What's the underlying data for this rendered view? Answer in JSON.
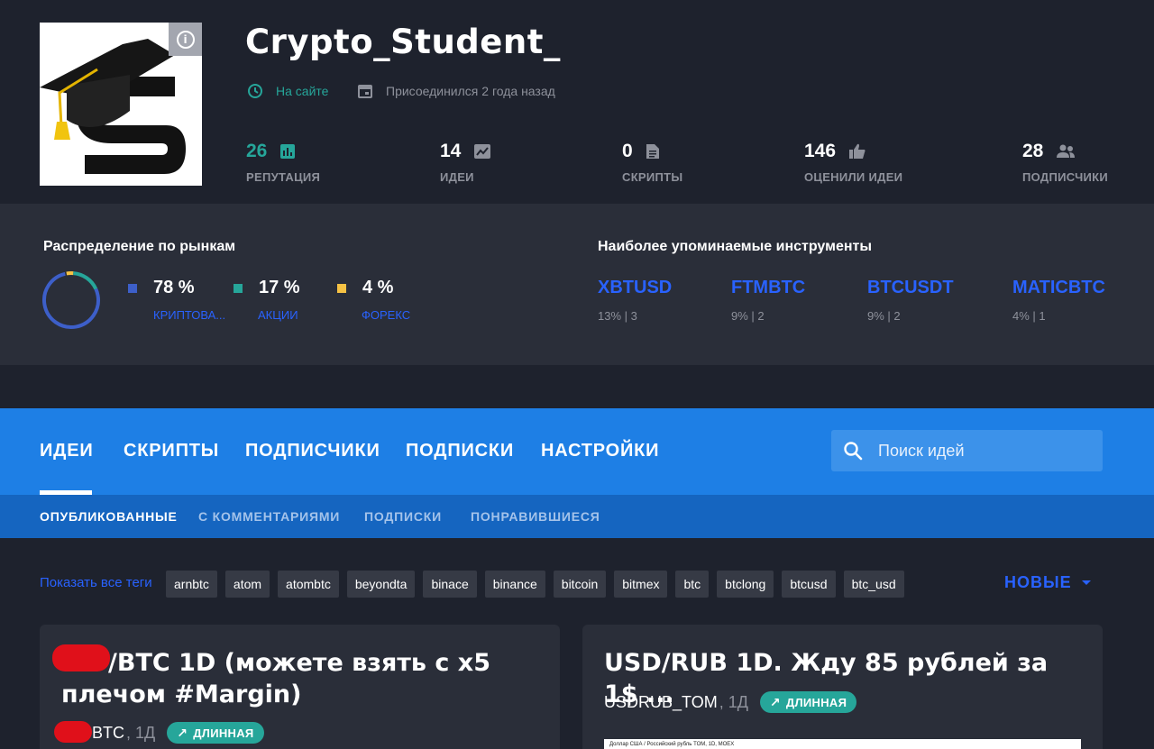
{
  "profile": {
    "username": "Crypto_Student_",
    "status": "На сайте",
    "joined": "Присоединился 2 года назад",
    "stats": [
      {
        "value": "26",
        "label": "РЕПУТАЦИЯ",
        "icon": "bar-chart-icon"
      },
      {
        "value": "14",
        "label": "ИДЕИ",
        "icon": "chart-line-icon"
      },
      {
        "value": "0",
        "label": "СКРИПТЫ",
        "icon": "document-icon"
      },
      {
        "value": "146",
        "label": "ОЦЕНИЛИ ИДЕИ",
        "icon": "thumbs-up-icon"
      },
      {
        "value": "28",
        "label": "ПОДПИСЧИКИ",
        "icon": "people-icon"
      }
    ]
  },
  "market": {
    "title": "Распределение по рынкам",
    "segments": [
      {
        "pct": "78 %",
        "label": "КРИПТОВА...",
        "color": "#3d5fc9",
        "fraction": 0.78
      },
      {
        "pct": "17 %",
        "label": "АКЦИИ",
        "color": "#26a69a",
        "fraction": 0.17
      },
      {
        "pct": "4 %",
        "label": "ФОРЕКС",
        "color": "#f6c244",
        "fraction": 0.04
      }
    ],
    "instruments_title": "Наиболее упоминаемые инструменты",
    "instruments": [
      {
        "symbol": "XBTUSD",
        "count": "13% | 3"
      },
      {
        "symbol": "FTMBTC",
        "count": "9% | 2"
      },
      {
        "symbol": "BTCUSDT",
        "count": "9% | 2"
      },
      {
        "symbol": "MATICBTC",
        "count": "4% | 1"
      }
    ]
  },
  "nav": {
    "tabs": [
      "ИДЕИ",
      "СКРИПТЫ",
      "ПОДПИСЧИКИ",
      "ПОДПИСКИ",
      "НАСТРОЙКИ"
    ],
    "search_placeholder": "Поиск идей",
    "subtabs": [
      "ОПУБЛИКОВАННЫЕ",
      "С КОММЕНТАРИЯМИ",
      "ПОДПИСКИ",
      "ПОНРАВИВШИЕСЯ"
    ]
  },
  "tags": {
    "show_all": "Показать все теги",
    "items": [
      "arnbtc",
      "atom",
      "atombtc",
      "beyondta",
      "binace",
      "binance",
      "bitcoin",
      "bitmex",
      "btc",
      "btclong",
      "btcusd",
      "btc_usd"
    ]
  },
  "sort": {
    "label": "НОВЫЕ"
  },
  "cards": [
    {
      "title": "/BTC 1D (можете взять с x5 плечом #Margin)",
      "symbol": "BTC",
      "timeframe": ", 1Д",
      "badge": "ДЛИННАЯ"
    },
    {
      "title": "USD/RUB 1D. Жду 85 рублей за 1$ ...",
      "symbol": "USDRUB_TOM",
      "timeframe": ", 1Д",
      "badge": "ДЛИННАЯ",
      "preview_caption": "Доллар США / Российский рубль TOM, 1D, MOEX"
    }
  ],
  "colors": {
    "accent": "#2962ff",
    "nav": "#1e7fe5",
    "subnav": "#1565c0",
    "green": "#26a69a",
    "bg": "#1e222d",
    "panel": "#2a2e39"
  }
}
